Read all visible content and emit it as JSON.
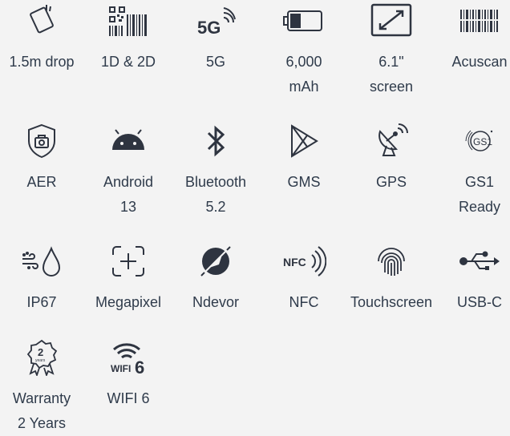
{
  "features": [
    {
      "label": "1.5m drop",
      "icon": "drop-test-icon"
    },
    {
      "label": "1D & 2D",
      "icon": "barcode-qr-icon"
    },
    {
      "label": "5G",
      "icon": "5g-icon"
    },
    {
      "label": "6,000\nmAh",
      "icon": "battery-icon"
    },
    {
      "label": "6.1\"\nscreen",
      "icon": "screen-size-icon"
    },
    {
      "label": "Acuscan",
      "icon": "acuscan-barcode-icon"
    },
    {
      "label": "AER",
      "icon": "aer-shield-icon"
    },
    {
      "label": "Android\n13",
      "icon": "android-icon"
    },
    {
      "label": "Bluetooth\n5.2",
      "icon": "bluetooth-icon"
    },
    {
      "label": "GMS",
      "icon": "google-play-icon"
    },
    {
      "label": "GPS",
      "icon": "satellite-dish-icon"
    },
    {
      "label": "GS1\nReady",
      "icon": "gs1-icon"
    },
    {
      "label": "IP67",
      "icon": "water-dust-icon"
    },
    {
      "label": "Megapixel",
      "icon": "camera-focus-icon"
    },
    {
      "label": "Ndevor",
      "icon": "ndevor-icon"
    },
    {
      "label": "NFC",
      "icon": "nfc-icon"
    },
    {
      "label": "Touchscreen",
      "icon": "fingerprint-touch-icon"
    },
    {
      "label": "USB-C",
      "icon": "usb-icon"
    },
    {
      "label": "Warranty\n2 Years",
      "icon": "warranty-badge-icon"
    },
    {
      "label": "WIFI 6",
      "icon": "wifi6-icon"
    }
  ],
  "icon_texts": {
    "five_g": "5G",
    "nfc": "NFC",
    "gs1": "GS1",
    "warranty_num": "2",
    "warranty_word": "years",
    "wifi_word": "WIFI",
    "wifi_num": "6"
  },
  "colors": {
    "background": "#f3f3f3",
    "icon": "#2e3440",
    "text": "#2f3b4b"
  }
}
